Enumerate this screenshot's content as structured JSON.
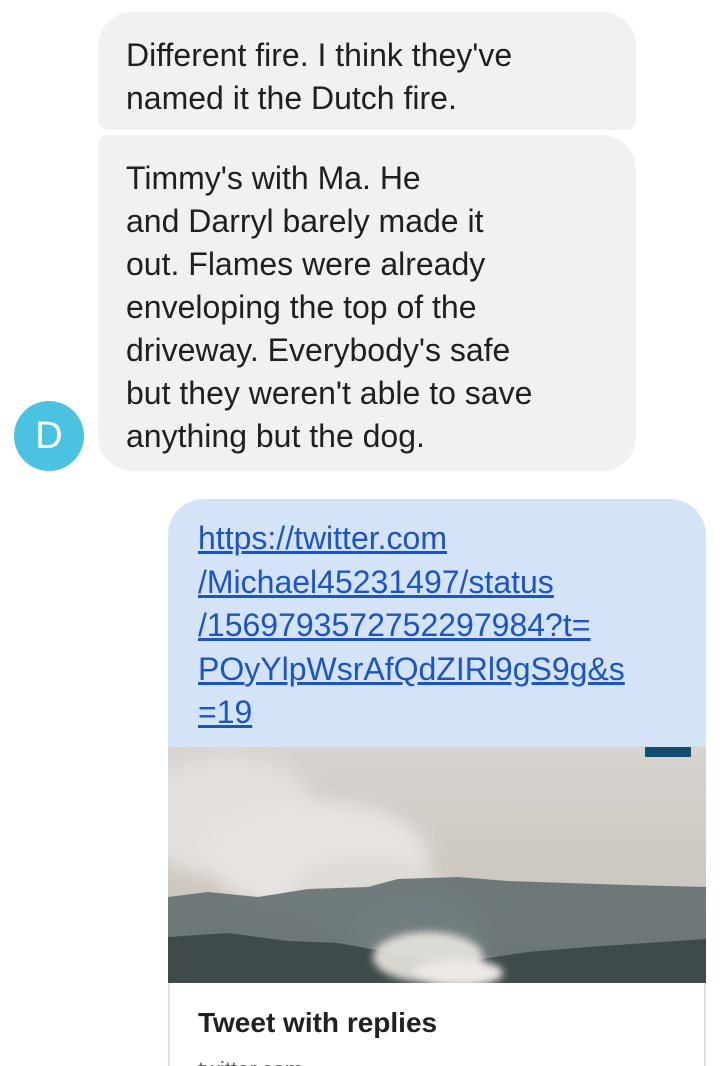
{
  "messages": [
    {
      "direction": "incoming",
      "text": "Different fire. I think they've\nnamed it the Dutch fire."
    },
    {
      "direction": "incoming",
      "text": "Timmy's with Ma. He\nand Darryl barely made it\nout. Flames were already\nenveloping the top of the\ndriveway. Everybody's safe\nbut they weren't able to save\nanything but the dog."
    }
  ],
  "sender": {
    "avatar_initial": "D",
    "avatar_color": "#4cc2e3"
  },
  "outgoing": {
    "link_text": "https://twitter.com\n/Michael45231497/status\n/1569793572752297984?t=\nPOyYlpWsrAfQdZIRl9gS9g&s\n=19",
    "link_color": "#1a55c7",
    "bubble_color": "#d5e3f8",
    "preview": {
      "image": "wildfire-smoke-over-forest",
      "title": "Tweet with replies",
      "subtitle": "twitter.com"
    }
  }
}
